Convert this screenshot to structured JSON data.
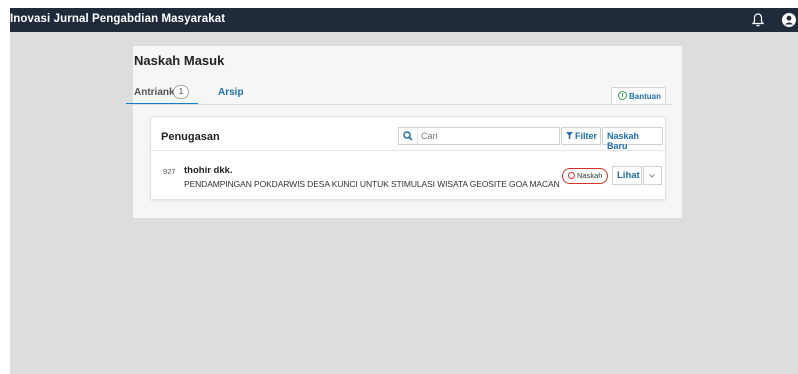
{
  "app": {
    "title": "Inovasi Jurnal Pengabdian Masyarakat"
  },
  "header": {
    "icons": [
      "bell-icon",
      "user-icon"
    ]
  },
  "page": {
    "title": "Naskah Masuk"
  },
  "tabs": [
    {
      "label": "Antrianku",
      "count": "1",
      "active": true
    },
    {
      "label": "Arsip",
      "active": false
    }
  ],
  "help": {
    "label": "Bantuan"
  },
  "list": {
    "title": "Penugasan",
    "search_placeholder": "Cari",
    "filter_label": "Filter",
    "new_label": "Naskah Baru"
  },
  "submissions": [
    {
      "id": "927",
      "authors": "thohir dkk.",
      "title": "PENDAMPINGAN POKDARWIS DESA KUNCI UNTUK STIMULASI WISATA GEOSITE GOA MACAN",
      "stage": "Naskah",
      "view_label": "Lihat"
    }
  ],
  "colors": {
    "topbar": "#1f2a3a",
    "link": "#1f6fae",
    "active_tab": "#0e7fcf",
    "stage_badge": "#d0342c",
    "help_icon": "#2e9e4e"
  }
}
